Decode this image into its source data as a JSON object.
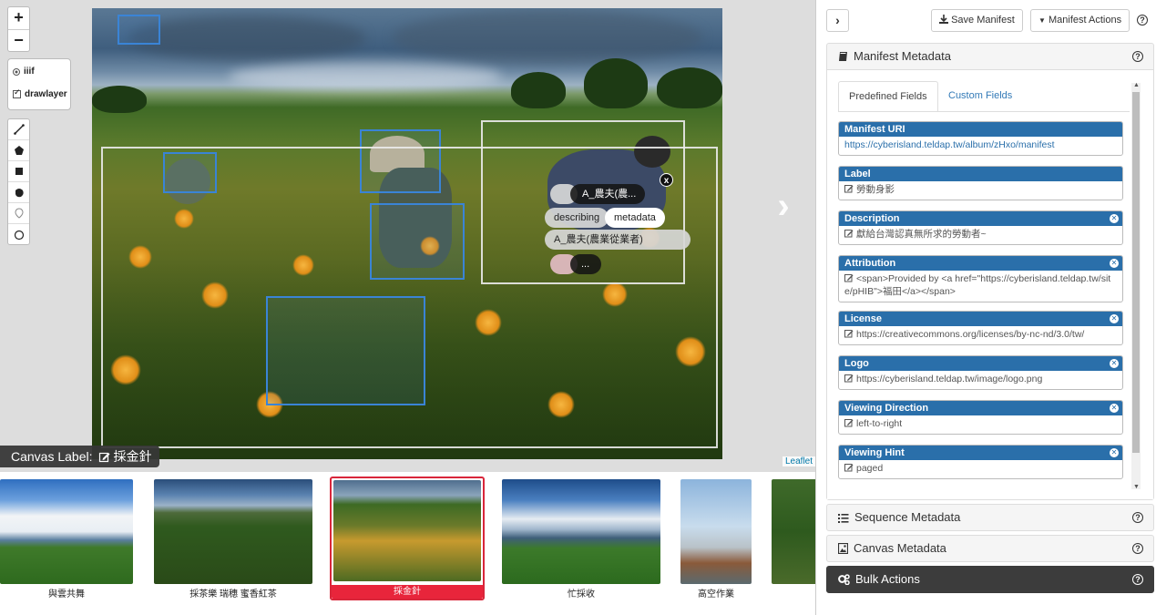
{
  "viewer": {
    "zoom_in": "+",
    "zoom_out": "−",
    "layers": {
      "base": "iiif",
      "overlay": "drawlayer"
    },
    "canvas_label_prefix": "Canvas Label:",
    "canvas_label_value": "採金針",
    "attribution": "Leaflet",
    "popup": {
      "title_tag": "A_農夫(農...",
      "tag_describing": "describing",
      "tag_metadata": "metadata",
      "value_tag": "A_農夫(農業從業者)",
      "more_tag": "...",
      "close": "x"
    }
  },
  "thumbnails": [
    {
      "caption": "與雲共舞"
    },
    {
      "caption": "採茶樂 瑞穗 蜜香紅茶"
    },
    {
      "caption": "採金針",
      "active": true
    },
    {
      "caption": "忙採收"
    },
    {
      "caption": "高空作業"
    },
    {
      "caption": ""
    }
  ],
  "panel": {
    "save_label": "Save Manifest",
    "actions_label": "Manifest Actions",
    "manifest_metadata_title": "Manifest Metadata",
    "tabs": {
      "predefined": "Predefined Fields",
      "custom": "Custom Fields"
    },
    "fields": [
      {
        "label": "Manifest URI",
        "value": "https://cyberisland.teldap.tw/album/zHxo/manifest",
        "removable": false,
        "editable": false
      },
      {
        "label": "Label",
        "value": "勞動身影",
        "removable": false,
        "editable": true
      },
      {
        "label": "Description",
        "value": "獻給台灣認真無所求的勞動者~",
        "removable": true,
        "editable": true
      },
      {
        "label": "Attribution",
        "value": "<span>Provided by <a href=\"https://cyberisland.teldap.tw/site/pHIB\">福田</a></span>",
        "removable": true,
        "editable": true
      },
      {
        "label": "License",
        "value": "https://creativecommons.org/licenses/by-nc-nd/3.0/tw/",
        "removable": true,
        "editable": true
      },
      {
        "label": "Logo",
        "value": "https://cyberisland.teldap.tw/image/logo.png",
        "removable": true,
        "editable": true
      },
      {
        "label": "Viewing Direction",
        "value": "left-to-right",
        "removable": true,
        "editable": true
      },
      {
        "label": "Viewing Hint",
        "value": "paged",
        "removable": true,
        "editable": true
      }
    ],
    "sequence_metadata_title": "Sequence Metadata",
    "canvas_metadata_title": "Canvas Metadata",
    "bulk_actions_title": "Bulk Actions"
  },
  "colors": {
    "accent": "#2a6faa",
    "active_thumb": "#e8253b",
    "annotation": "#3a84d6",
    "dark_section": "#3c3c3c"
  }
}
